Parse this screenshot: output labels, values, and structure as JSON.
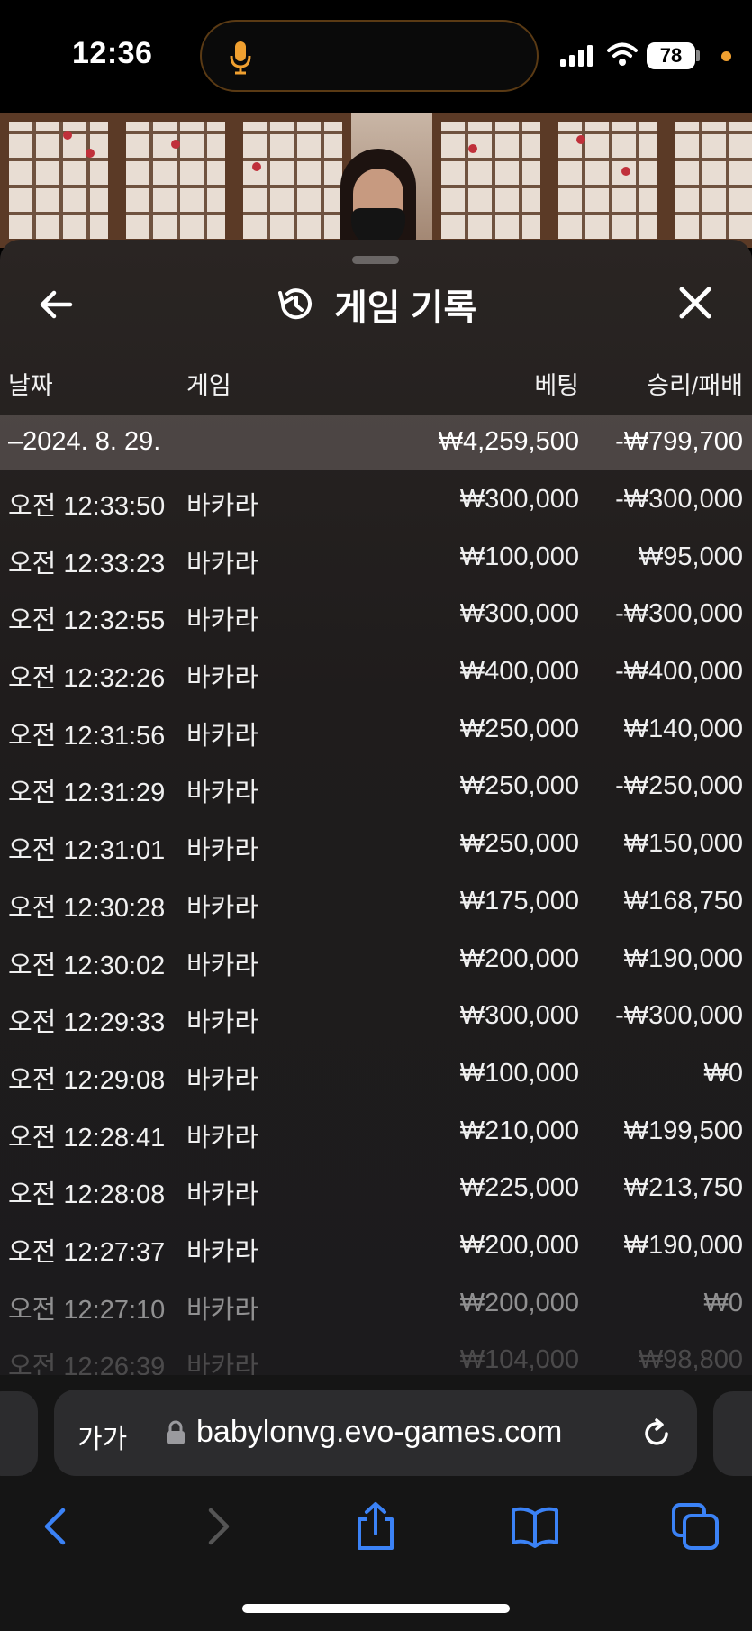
{
  "status_bar": {
    "time": "12:36",
    "battery": "78"
  },
  "colors": {
    "accent": "#3b82f6",
    "orange_indicator": "#f0a030",
    "sheet_bg": "#1f1c1c"
  },
  "sheet": {
    "title": "게임 기록",
    "back_icon": "arrow-left-icon",
    "history_icon": "history-clock-icon",
    "close_icon": "close-icon"
  },
  "table": {
    "headers": {
      "date": "날짜",
      "game": "게임",
      "bet": "베팅",
      "win_loss": "승리/패배"
    },
    "summary": {
      "date": "–2024. 8. 29.",
      "bet": "₩4,259,500",
      "win_loss": "-₩799,700"
    },
    "rows": [
      {
        "time": "오전 12:33:50",
        "game": "바카라",
        "bet": "₩300,000",
        "win_loss": "-₩300,000"
      },
      {
        "time": "오전 12:33:23",
        "game": "바카라",
        "bet": "₩100,000",
        "win_loss": "₩95,000"
      },
      {
        "time": "오전 12:32:55",
        "game": "바카라",
        "bet": "₩300,000",
        "win_loss": "-₩300,000"
      },
      {
        "time": "오전 12:32:26",
        "game": "바카라",
        "bet": "₩400,000",
        "win_loss": "-₩400,000"
      },
      {
        "time": "오전 12:31:56",
        "game": "바카라",
        "bet": "₩250,000",
        "win_loss": "₩140,000"
      },
      {
        "time": "오전 12:31:29",
        "game": "바카라",
        "bet": "₩250,000",
        "win_loss": "-₩250,000"
      },
      {
        "time": "오전 12:31:01",
        "game": "바카라",
        "bet": "₩250,000",
        "win_loss": "₩150,000"
      },
      {
        "time": "오전 12:30:28",
        "game": "바카라",
        "bet": "₩175,000",
        "win_loss": "₩168,750"
      },
      {
        "time": "오전 12:30:02",
        "game": "바카라",
        "bet": "₩200,000",
        "win_loss": "₩190,000"
      },
      {
        "time": "오전 12:29:33",
        "game": "바카라",
        "bet": "₩300,000",
        "win_loss": "-₩300,000"
      },
      {
        "time": "오전 12:29:08",
        "game": "바카라",
        "bet": "₩100,000",
        "win_loss": "₩0"
      },
      {
        "time": "오전 12:28:41",
        "game": "바카라",
        "bet": "₩210,000",
        "win_loss": "₩199,500"
      },
      {
        "time": "오전 12:28:08",
        "game": "바카라",
        "bet": "₩225,000",
        "win_loss": "₩213,750"
      },
      {
        "time": "오전 12:27:37",
        "game": "바카라",
        "bet": "₩200,000",
        "win_loss": "₩190,000"
      },
      {
        "time": "오전 12:27:10",
        "game": "바카라",
        "bet": "₩200,000",
        "win_loss": "₩0"
      },
      {
        "time": "오전 12:26:39",
        "game": "바카라",
        "bet": "₩104,000",
        "win_loss": "₩98,800"
      }
    ]
  },
  "safari": {
    "aa_label": "가가",
    "url": "babylonvg.evo-games.com",
    "toolbar_icons": [
      "back-icon",
      "forward-icon",
      "share-icon",
      "bookmarks-icon",
      "tabs-icon"
    ]
  }
}
